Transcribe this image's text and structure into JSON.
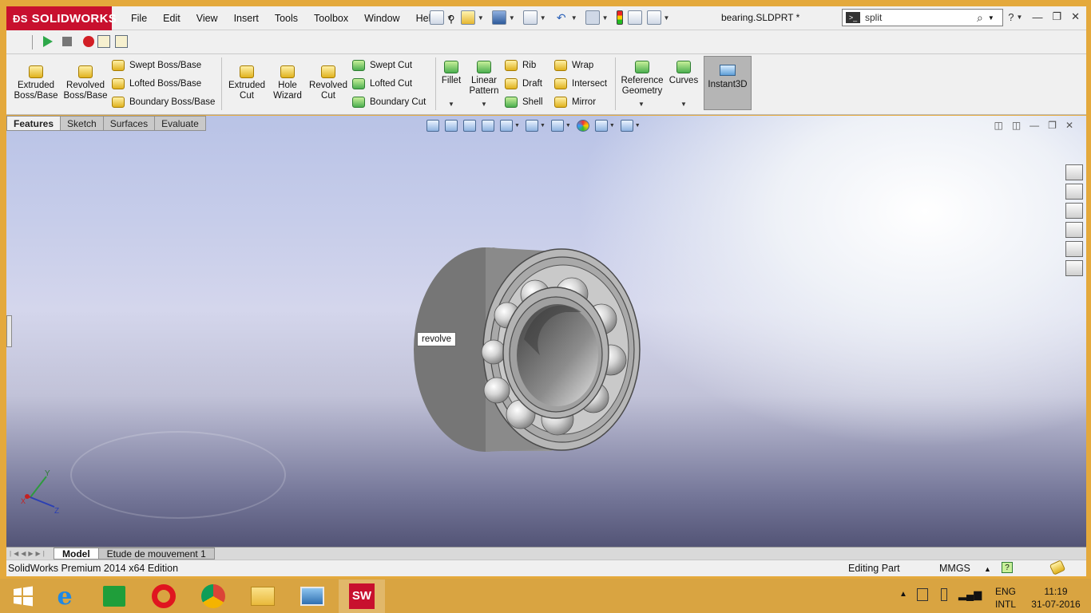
{
  "app": {
    "logo_text": "SOLIDWORKS",
    "menus": [
      "File",
      "Edit",
      "View",
      "Insert",
      "Tools",
      "Toolbox",
      "Window",
      "Help"
    ],
    "document_title": "bearing.SLDPRT *",
    "search_value": "split"
  },
  "ribbon": {
    "extruded_boss": "Extruded Boss/Base",
    "revolved_boss": "Revolved Boss/Base",
    "swept_boss": "Swept Boss/Base",
    "lofted_boss": "Lofted Boss/Base",
    "boundary_boss": "Boundary Boss/Base",
    "extruded_cut": "Extruded Cut",
    "hole_wizard": "Hole Wizard",
    "revolved_cut": "Revolved Cut",
    "swept_cut": "Swept Cut",
    "lofted_cut": "Lofted Cut",
    "boundary_cut": "Boundary Cut",
    "fillet": "Fillet",
    "linear_pattern": "Linear Pattern",
    "rib": "Rib",
    "draft": "Draft",
    "shell": "Shell",
    "wrap": "Wrap",
    "intersect": "Intersect",
    "mirror": "Mirror",
    "reference_geometry": "Reference Geometry",
    "curves": "Curves",
    "instant3d": "Instant3D"
  },
  "tabs": [
    "Features",
    "Sketch",
    "Surfaces",
    "Evaluate"
  ],
  "viewport": {
    "tooltip": "revolve",
    "axis_labels": {
      "x": "X",
      "y": "Y",
      "z": "Z"
    }
  },
  "bottom_tabs": [
    "Model",
    "Etude de mouvement 1"
  ],
  "status": {
    "edition": "SolidWorks Premium 2014 x64 Edition",
    "mode": "Editing Part",
    "units": "MMGS"
  },
  "taskbar": {
    "lang_top": "ENG",
    "lang_bottom": "INTL",
    "time": "11:19",
    "date": "31-07-2016"
  },
  "colors": {
    "brand": "#c8102e",
    "frame": "#e4a93c",
    "taskbar": "#d9a441"
  }
}
